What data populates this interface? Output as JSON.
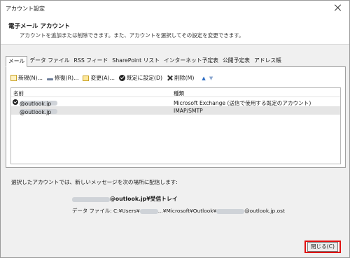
{
  "window": {
    "title": "アカウント設定"
  },
  "header": {
    "title": "電子メール アカウント",
    "description": "アカウントを追加または削除できます。また、アカウントを選択してその設定を変更できます。"
  },
  "tabs": [
    {
      "label": "メール",
      "active": true
    },
    {
      "label": "データ ファイル"
    },
    {
      "label": "RSS フィード"
    },
    {
      "label": "SharePoint リスト"
    },
    {
      "label": "インターネット予定表"
    },
    {
      "label": "公開予定表"
    },
    {
      "label": "アドレス帳"
    }
  ],
  "toolbar": {
    "new_label": "新規(N)...",
    "repair_label": "修復(R)...",
    "change_label": "変更(A)...",
    "default_label": "既定に設定(D)",
    "delete_label": "削除(M)",
    "move_up": "▲",
    "move_down": "▼"
  },
  "list": {
    "col_name": "名前",
    "col_type": "種類",
    "rows": [
      {
        "name": "@outlook.jp",
        "type": "Microsoft Exchange (送信で使用する既定のアカウント)",
        "default": true
      },
      {
        "name": "@outlook.jp",
        "type": "IMAP/SMTP",
        "selected": true
      }
    ]
  },
  "delivery": {
    "label": "選択したアカウントでは、新しいメッセージを次の場所に配信します:",
    "inbox": "@outlook.jp¥受信トレイ",
    "datafile_label": "データ ファイル:",
    "datafile_path_a": "C:¥Users¥",
    "datafile_path_b": "...¥Microsoft¥Outlook¥",
    "datafile_path_c": "@outlook.jp.ost"
  },
  "footer": {
    "close_label": "閉じる(C)"
  },
  "colors": {
    "highlight": "#e01010",
    "selected_row": "#e5e5e5"
  }
}
